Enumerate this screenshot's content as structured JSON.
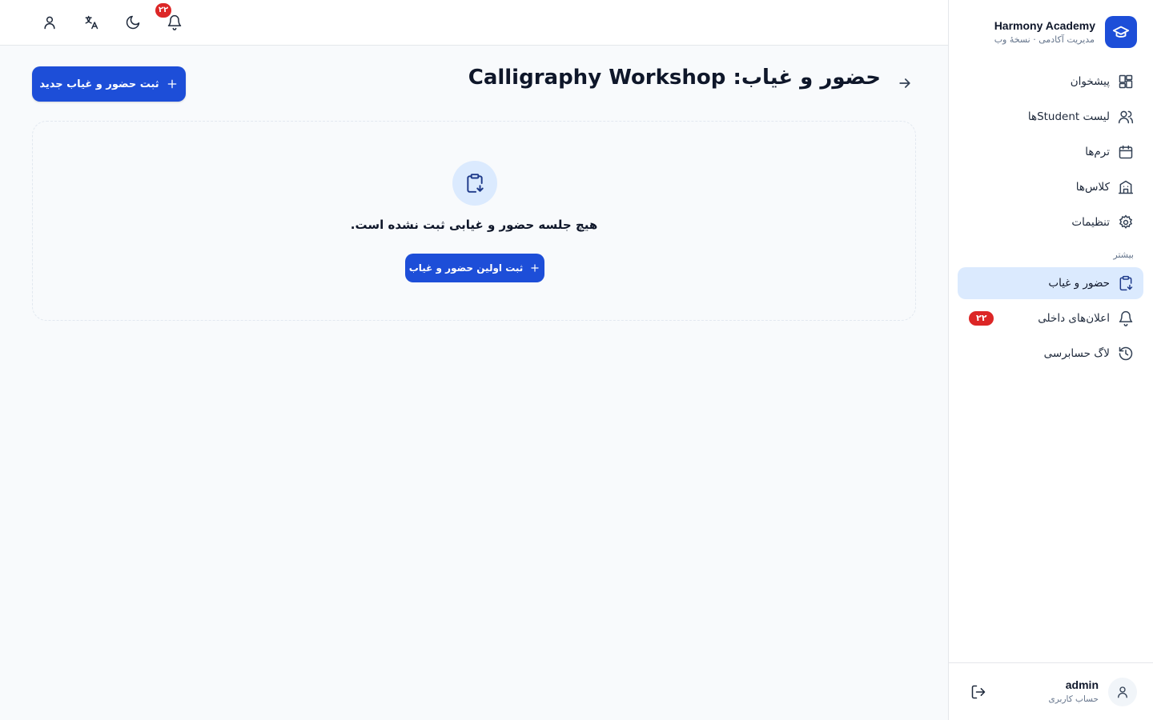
{
  "brand": {
    "name": "Harmony Academy",
    "subtitle": "مدیریت آکادمی · نسخهٔ وب"
  },
  "nav": {
    "items": [
      {
        "label": "پیشخوان",
        "icon": "dashboard-icon"
      },
      {
        "label": "لیست Studentها",
        "icon": "users-icon"
      },
      {
        "label": "ترم‌ها",
        "icon": "calendar-icon"
      },
      {
        "label": "کلاس‌ها",
        "icon": "building-icon"
      },
      {
        "label": "تنظیمات",
        "icon": "gear-icon"
      }
    ],
    "section_label": "بیشتر",
    "more_items": [
      {
        "label": "حضور و غیاب",
        "icon": "clipboard-icon",
        "active": true
      },
      {
        "label": "اعلان‌های داخلی",
        "icon": "bell-icon",
        "badge": "۲۲"
      },
      {
        "label": "لاگ حسابرسی",
        "icon": "history-icon"
      }
    ]
  },
  "user": {
    "name": "admin",
    "role": "حساب کاربری"
  },
  "topbar": {
    "notification_count": "۲۲"
  },
  "page": {
    "title": "حضور و غیاب: Calligraphy Workshop",
    "new_button_label": "ثبت حضور و غیاب جدید",
    "empty_text": "هیچ جلسه حضور و غیابی ثبت نشده است.",
    "empty_button_label": "ثبت اولین حضور و غیاب"
  },
  "colors": {
    "accent": "#1d4ed8",
    "active_bg": "#dbeafe",
    "badge": "#dc2626"
  }
}
